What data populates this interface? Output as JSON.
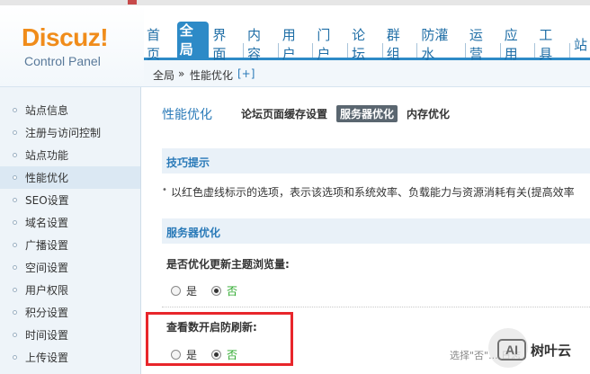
{
  "logo": {
    "brand": "Discuz!",
    "subtitle": "Control Panel"
  },
  "nav": {
    "tabs": [
      {
        "label": "首页"
      },
      {
        "label": "全局",
        "active": true
      },
      {
        "label": "界面"
      },
      {
        "label": "内容"
      },
      {
        "label": "用户"
      },
      {
        "label": "门户"
      },
      {
        "label": "论坛"
      },
      {
        "label": "群组"
      },
      {
        "label": "防灌水"
      },
      {
        "label": "运营"
      },
      {
        "label": "应用"
      },
      {
        "label": "工具"
      },
      {
        "label": "站"
      }
    ]
  },
  "breadcrumb": {
    "root": "全局",
    "sep": "»",
    "current": "性能优化",
    "add": "[+]"
  },
  "sidebar": {
    "items": [
      {
        "label": "站点信息"
      },
      {
        "label": "注册与访问控制"
      },
      {
        "label": "站点功能"
      },
      {
        "label": "性能优化",
        "active": true
      },
      {
        "label": "SEO设置"
      },
      {
        "label": "域名设置"
      },
      {
        "label": "广播设置"
      },
      {
        "label": "空间设置"
      },
      {
        "label": "用户权限"
      },
      {
        "label": "积分设置"
      },
      {
        "label": "时间设置"
      },
      {
        "label": "上传设置"
      }
    ]
  },
  "main": {
    "title": "性能优化",
    "subtabs": [
      {
        "label": "论坛页面缓存设置"
      },
      {
        "label": "服务器优化",
        "active": true
      },
      {
        "label": "内存优化"
      }
    ],
    "tips_header": "技巧提示",
    "tips_bullet": "•",
    "tips_text": "以红色虚线标示的选项，表示该选项和系统效率、负载能力与资源消耗有关(提高效率",
    "server_header": "服务器优化",
    "field1": {
      "label": "是否优化更新主题浏览量:",
      "yes": "是",
      "no": "否",
      "selected": "no"
    },
    "field2": {
      "label": "查看数开启防刷新:",
      "yes": "是",
      "no": "否",
      "selected": "no"
    },
    "hint": "选择\"否\"... 日志"
  },
  "watermark": {
    "badge": "AI",
    "text": "树叶云"
  },
  "colors": {
    "accent": "#2d8ac7",
    "logo_orange": "#f08c1a",
    "highlight_box": "#e8262b",
    "no_green": "#2aa82a"
  }
}
